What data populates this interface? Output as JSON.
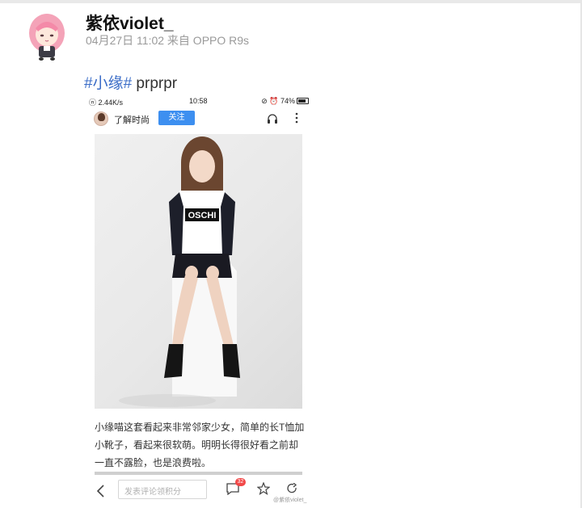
{
  "post": {
    "author": "紫依violet_",
    "meta": "04月27日 11:02 来自 OPPO R9s",
    "hashtag": "#小缘#",
    "text": " prprpr"
  },
  "embedded": {
    "status": {
      "left": "ⓝ 2.44K/s",
      "time": "10:58",
      "right": "⊘ ⏰ 74%"
    },
    "header": {
      "title": "了解时尚",
      "follow_label": "关注"
    },
    "caption": "小缘喵这套看起来非常邻家少女，简单的长T恤加小靴子，看起来很软萌。明明长得很好看之前却一直不露脸，也是浪费啦。",
    "comment_placeholder": "发表评论领积分",
    "comment_count": "32",
    "watermark": "@紫依violet_"
  },
  "colors": {
    "hashtag": "#3a6cc7",
    "follow_button": "#3d8ff0",
    "badge": "#f24848"
  }
}
